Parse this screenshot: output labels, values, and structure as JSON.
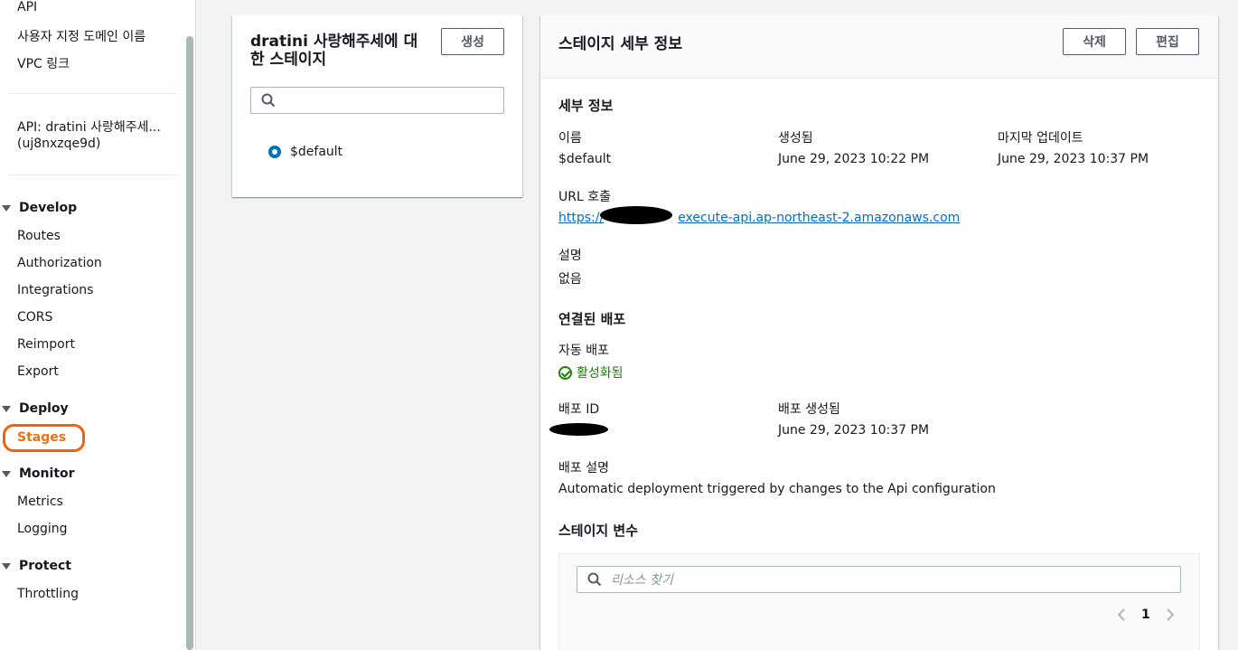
{
  "sidebar": {
    "top_links": [
      "API",
      "사용자 지정 도메인 이름",
      "VPC 링크"
    ],
    "api_label_line1": "API: dratini 사랑해주세...",
    "api_label_line2": "(uj8nxzqe9d)",
    "sections": [
      {
        "title": "Develop",
        "items": [
          "Routes",
          "Authorization",
          "Integrations",
          "CORS",
          "Reimport",
          "Export"
        ]
      },
      {
        "title": "Deploy",
        "items": [
          "Stages"
        ]
      },
      {
        "title": "Monitor",
        "items": [
          "Metrics",
          "Logging"
        ]
      },
      {
        "title": "Protect",
        "items": [
          "Throttling"
        ]
      }
    ],
    "active_item": "Stages",
    "highlight_color": "#f2620c"
  },
  "stages_panel": {
    "title": "dratini 사랑해주세에 대한 스테이지",
    "create_button": "생성",
    "search_placeholder": "",
    "stage_name": "$default"
  },
  "details_panel": {
    "title": "스테이지 세부 정보",
    "delete_button": "삭제",
    "edit_button": "편집",
    "section_details": "세부 정보",
    "name_label": "이름",
    "name_value": "$default",
    "created_label": "생성됨",
    "created_value": "June 29, 2023 10:22 PM",
    "updated_label": "마지막 업데이트",
    "updated_value": "June 29, 2023 10:37 PM",
    "url_label": "URL 호출",
    "url_prefix": "https://",
    "url_suffix": "execute-api.ap-northeast-2.amazonaws.com",
    "desc_label": "설명",
    "desc_value": "없음",
    "section_deploy": "연결된 배포",
    "auto_deploy_label": "자동 배포",
    "auto_deploy_value": "활성화됨",
    "deploy_id_label": "배포 ID",
    "deploy_created_label": "배포 생성됨",
    "deploy_created_value": "June 29, 2023 10:37 PM",
    "deploy_desc_label": "배포 설명",
    "deploy_desc_value": "Automatic deployment triggered by changes to the Api configuration",
    "section_vars": "스테이지 변수",
    "vars_search_placeholder": "리소스 찾기",
    "page_number": "1"
  }
}
